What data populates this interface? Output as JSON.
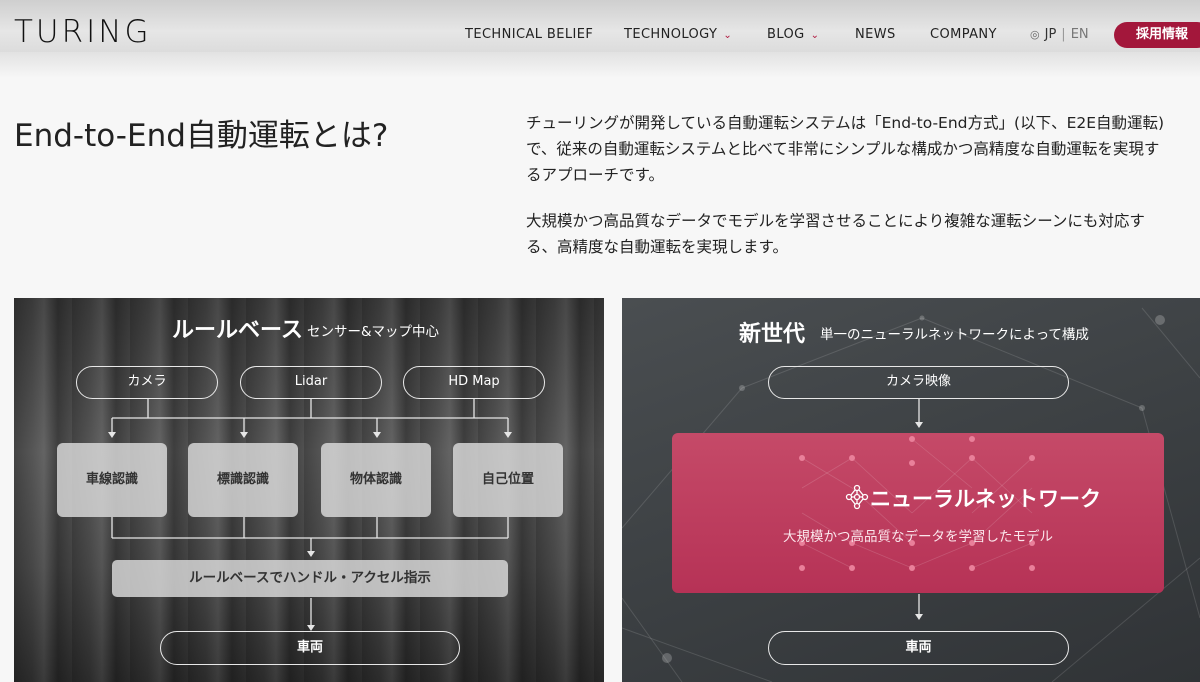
{
  "header": {
    "logo": "TURING",
    "nav": [
      {
        "label": "TECHNICAL BELIEF",
        "has_dropdown": false
      },
      {
        "label": "TECHNOLOGY",
        "has_dropdown": true
      },
      {
        "label": "BLOG",
        "has_dropdown": true
      },
      {
        "label": "NEWS",
        "has_dropdown": false
      },
      {
        "label": "COMPANY",
        "has_dropdown": false
      }
    ],
    "lang": {
      "jp": "JP",
      "separator": "|",
      "en": "EN"
    },
    "recruit_label": "採用情報",
    "accent_color": "#a3173b"
  },
  "intro": {
    "title": "End-to-End自動運転とは?",
    "paragraph1": [
      "チューリングが開発している自動運転システムは「End-to-End方式」(以下、E2E自動運転)",
      "で、従来の自動運転システムと比べて非常にシンプルな構成かつ高精度な自動運転を実現す",
      "るアプローチです。"
    ],
    "paragraph2": [
      "大規模かつ高品質なデータでモデルを学習させることにより複雑な運転シーンにも対応す",
      "る、高精度な自動運転を実現します。"
    ]
  },
  "left_panel": {
    "heading": "ルールベース",
    "subheading": "センサー&マップ中心",
    "inputs": [
      "カメラ",
      "Lidar",
      "HD Map"
    ],
    "modules": [
      "車線認識",
      "標識認識",
      "物体認識",
      "自己位置"
    ],
    "control": "ルールベースでハンドル・アクセル指示",
    "output": "車両"
  },
  "right_panel": {
    "heading": "新世代",
    "subheading": "単一のニューラルネットワークによって構成",
    "input": "カメラ映像",
    "network_title": "ニューラルネットワーク",
    "network_subtitle": "大規模かつ高品質なデータを学習したモデル",
    "output": "車両",
    "network_icon": "neural-network-icon"
  }
}
